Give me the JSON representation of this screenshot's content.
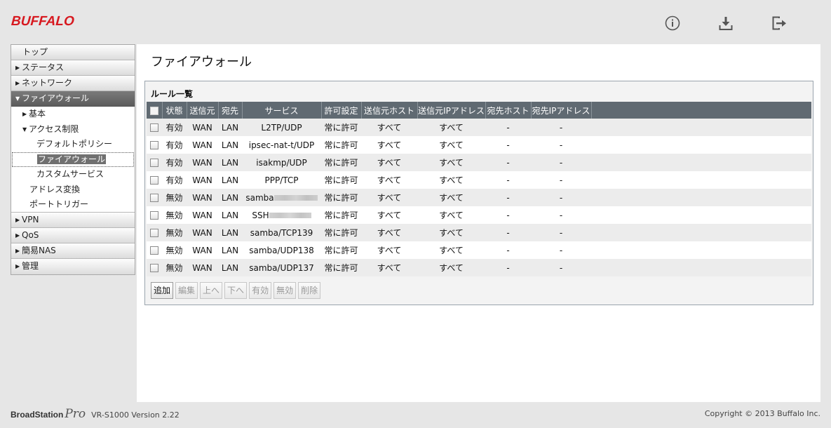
{
  "brand": {
    "logo": "BUFFALO",
    "accent": "#d71920"
  },
  "header_icons": [
    {
      "name": "info-icon"
    },
    {
      "name": "download-icon"
    },
    {
      "name": "logout-icon"
    }
  ],
  "sidebar": {
    "items": [
      {
        "label": "トップ"
      },
      {
        "label": "ステータス",
        "arrow": "▶"
      },
      {
        "label": "ネットワーク",
        "arrow": "▶"
      },
      {
        "label": "ファイアウォール",
        "arrow": "▼"
      },
      {
        "label": "基本",
        "arrow": "▶"
      },
      {
        "label": "アクセス制限",
        "arrow": "▼"
      },
      {
        "label": "デフォルトポリシー"
      },
      {
        "label": "ファイアウォール"
      },
      {
        "label": "カスタムサービス"
      },
      {
        "label": "アドレス変換"
      },
      {
        "label": "ポートトリガー"
      },
      {
        "label": "VPN",
        "arrow": "▶"
      },
      {
        "label": "QoS",
        "arrow": "▶"
      },
      {
        "label": "簡易NAS",
        "arrow": "▶"
      },
      {
        "label": "管理",
        "arrow": "▶"
      }
    ]
  },
  "main": {
    "title": "ファイアウォール",
    "section_title": "ルール一覧",
    "columns": [
      "状態",
      "送信元",
      "宛先",
      "サービス",
      "許可設定",
      "送信元ホスト",
      "送信元IPアドレス",
      "宛先ホスト",
      "宛先IPアドレス"
    ],
    "rows": [
      {
        "status": "有効",
        "src": "WAN",
        "dst": "LAN",
        "service": "L2TP/UDP",
        "allow": "常に許可",
        "src_host": "すべて",
        "src_ip": "すべて",
        "dst_host": "-",
        "dst_ip": "-"
      },
      {
        "status": "有効",
        "src": "WAN",
        "dst": "LAN",
        "service": "ipsec-nat-t/UDP",
        "allow": "常に許可",
        "src_host": "すべて",
        "src_ip": "すべて",
        "dst_host": "-",
        "dst_ip": "-"
      },
      {
        "status": "有効",
        "src": "WAN",
        "dst": "LAN",
        "service": "isakmp/UDP",
        "allow": "常に許可",
        "src_host": "すべて",
        "src_ip": "すべて",
        "dst_host": "-",
        "dst_ip": "-"
      },
      {
        "status": "有効",
        "src": "WAN",
        "dst": "LAN",
        "service": "PPP/TCP",
        "allow": "常に許可",
        "src_host": "すべて",
        "src_ip": "すべて",
        "dst_host": "-",
        "dst_ip": "-"
      },
      {
        "status": "無効",
        "src": "WAN",
        "dst": "LAN",
        "service": "samba",
        "allow": "常に許可",
        "src_host": "すべて",
        "src_ip": "すべて",
        "dst_host": "-",
        "dst_ip": "-"
      },
      {
        "status": "無効",
        "src": "WAN",
        "dst": "LAN",
        "service": "SSH",
        "allow": "常に許可",
        "src_host": "すべて",
        "src_ip": "すべて",
        "dst_host": "-",
        "dst_ip": "-"
      },
      {
        "status": "無効",
        "src": "WAN",
        "dst": "LAN",
        "service": "samba/TCP139",
        "allow": "常に許可",
        "src_host": "すべて",
        "src_ip": "すべて",
        "dst_host": "-",
        "dst_ip": "-"
      },
      {
        "status": "無効",
        "src": "WAN",
        "dst": "LAN",
        "service": "samba/UDP138",
        "allow": "常に許可",
        "src_host": "すべて",
        "src_ip": "すべて",
        "dst_host": "-",
        "dst_ip": "-"
      },
      {
        "status": "無効",
        "src": "WAN",
        "dst": "LAN",
        "service": "samba/UDP137",
        "allow": "常に許可",
        "src_host": "すべて",
        "src_ip": "すべて",
        "dst_host": "-",
        "dst_ip": "-"
      }
    ],
    "buttons": {
      "add": "追加",
      "edit": "編集",
      "up": "上へ",
      "down": "下へ",
      "enable": "有効",
      "disable": "無効",
      "delete": "削除"
    }
  },
  "footer": {
    "brand_a": "BroadStation",
    "brand_b": "Pro",
    "version": "VR-S1000 Version 2.22",
    "copyright": "Copyright © 2013 Buffalo Inc."
  }
}
